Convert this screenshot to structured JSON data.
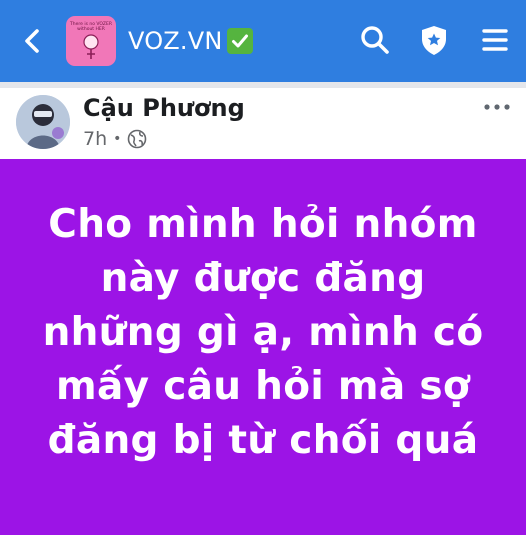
{
  "header": {
    "group_name": "VOZ.VN",
    "thumb_text": "There is no VOZER without HER",
    "icons": [
      "back-icon",
      "search-icon",
      "admin-shield-icon",
      "menu-icon"
    ],
    "verified_icon": "check-icon",
    "bar_color": "#2f7ee0"
  },
  "post": {
    "author": "Cậu Phương",
    "time": "7h",
    "separator": "•",
    "privacy_icon": "globe-icon",
    "more_icon": "more-icon",
    "background": "#9c14e6",
    "text_lines": [
      "Cho mình hỏi nhóm",
      "này được đăng",
      "những gì ạ, mình có",
      "mấy câu hỏi mà sợ",
      "đăng bị từ chối quá"
    ]
  }
}
